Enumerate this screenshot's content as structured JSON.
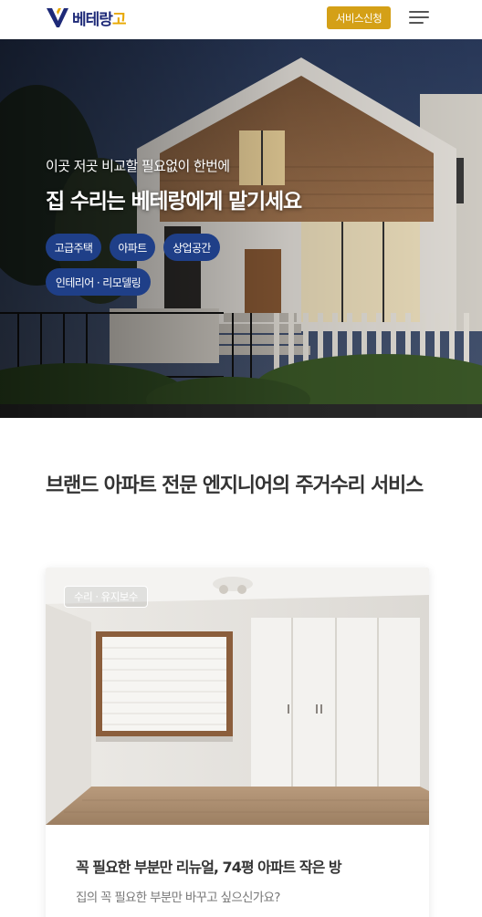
{
  "header": {
    "logo_text": "베테랑",
    "logo_text_accent": "고",
    "cta_label": "서비스신청",
    "menu_icon": "hamburger-menu-icon"
  },
  "hero": {
    "subtitle": "이곳 저곳 비교할 필요없이 한번에",
    "title": "집 수리는 베테랑에게 맡기세요",
    "chips": [
      "고급주택",
      "아파트",
      "상업공간",
      "인테리어 · 리모델링"
    ]
  },
  "section": {
    "title": "브랜드 아파트 전문 엔지니어의 주거수리 서비스"
  },
  "card": {
    "badge": "수리 · 유지보수",
    "title": "꼭 필요한 부분만 리뉴얼, 74평 아파트 작은 방",
    "description": "집의 꼭 필요한 부분만 바꾸고 싶으신가요?"
  },
  "colors": {
    "brand_navy": "#1e2a78",
    "cta_gold": "#d4a017",
    "chip_blue": "#1f3f88"
  }
}
